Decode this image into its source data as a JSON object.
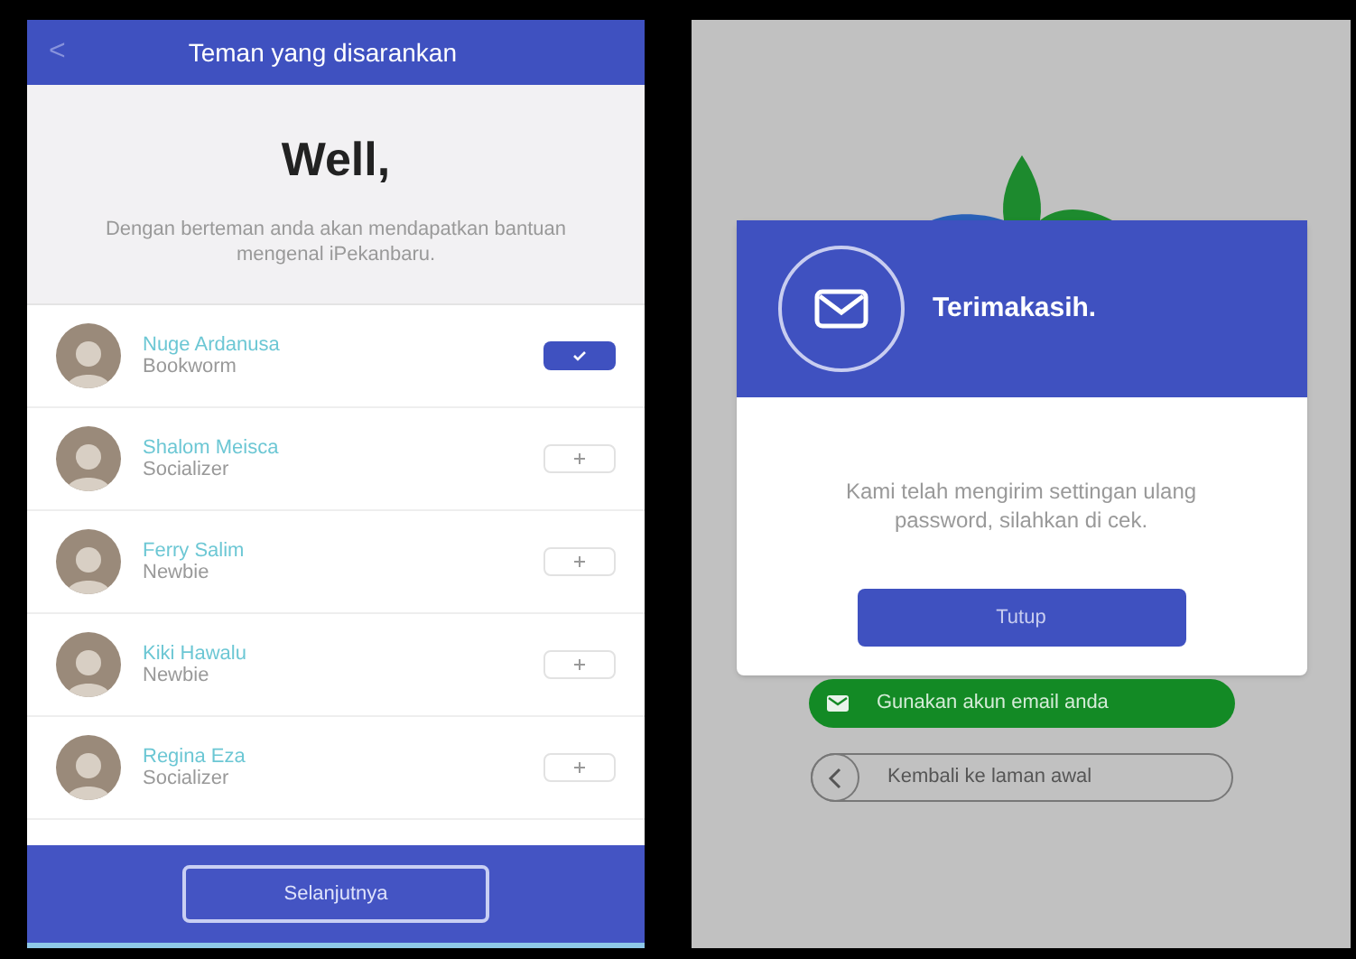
{
  "left_screen": {
    "header": {
      "back_icon": "<",
      "title": "Teman yang disarankan"
    },
    "intro": {
      "heading": "Well,",
      "text": "Dengan berteman anda akan mendapatkan bantuan mengenal iPekanbaru."
    },
    "friends": [
      {
        "name": "Nuge Ardanusa",
        "role": "Bookworm",
        "selected": true
      },
      {
        "name": "Shalom Meisca",
        "role": "Socializer",
        "selected": false
      },
      {
        "name": "Ferry Salim",
        "role": "Newbie",
        "selected": false
      },
      {
        "name": "Kiki Hawalu",
        "role": "Newbie",
        "selected": false
      },
      {
        "name": "Regina Eza",
        "role": "Socializer",
        "selected": false
      }
    ],
    "next_button": "Selanjutnya"
  },
  "right_screen": {
    "dialog": {
      "title": "Terimakasih.",
      "message": "Kami telah mengirim settingan ulang password, silahkan di cek.",
      "close_button": "Tutup"
    },
    "email_button": "Gunakan akun email anda",
    "back_button": "Kembali ke laman awal"
  }
}
